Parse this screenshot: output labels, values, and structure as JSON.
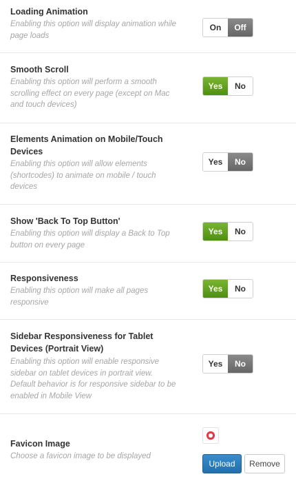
{
  "settings": [
    {
      "title": "Loading Animation",
      "description": "Enabling this option will display animation while page loads",
      "options": [
        "On",
        "Off"
      ],
      "selected": "Off"
    },
    {
      "title": "Smooth Scroll",
      "description": "Enabling this option will perform a smooth scrolling effect on every page (except on Mac and touch devices)",
      "options": [
        "Yes",
        "No"
      ],
      "selected": "Yes"
    },
    {
      "title": "Elements Animation on Mobile/Touch Devices",
      "description": "Enabling this option will allow elements (shortcodes) to animate on mobile / touch devices",
      "options": [
        "Yes",
        "No"
      ],
      "selected": "No"
    },
    {
      "title": "Show 'Back To Top Button'",
      "description": "Enabling this option will display a Back to Top button on every page",
      "options": [
        "Yes",
        "No"
      ],
      "selected": "Yes"
    },
    {
      "title": "Responsiveness",
      "description": "Enabling this option will make all pages responsive",
      "options": [
        "Yes",
        "No"
      ],
      "selected": "Yes"
    },
    {
      "title": "Sidebar Responsiveness for Tablet Devices (Portrait View)",
      "description": "Enabling this option will enable responsive sidebar on tablet devices in portrait view. Default behavior is for responsive sidebar to be enabled in Mobile View",
      "options": [
        "Yes",
        "No"
      ],
      "selected": "No"
    }
  ],
  "favicon": {
    "title": "Favicon Image",
    "description": "Choose a favicon image to be displayed",
    "upload_label": "Upload",
    "remove_label": "Remove",
    "preview_icon": "favicon-ring-icon"
  },
  "colors": {
    "yes_active": "#5f9d1d",
    "no_active": "#777777",
    "upload_button": "#2a7ab8",
    "favicon_ring": "#e8344a"
  }
}
